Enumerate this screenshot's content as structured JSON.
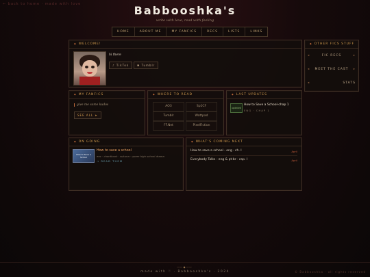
{
  "corner": {
    "top_left": "← back to home · made with love"
  },
  "header": {
    "title": "Babbooshka's",
    "tagline": "write with love, read with feeling"
  },
  "nav": [
    "HOME",
    "ABOUT ME",
    "MY FANFICS",
    "RECS",
    "LISTS",
    "LINKS"
  ],
  "welcome": {
    "heading": "WELCOME!",
    "greeting": "hi there",
    "links": [
      {
        "icon": "♪",
        "label": "TikTok"
      },
      {
        "icon": "✱",
        "label": "Tumblr"
      }
    ]
  },
  "other": {
    "heading": "OTHER FICS STUFF",
    "items": [
      "FIC RECS",
      "MEET THE CAST",
      "STATS"
    ]
  },
  "fanfics": {
    "heading": "MY FANFICS",
    "note": "give me some kudos",
    "button": "SEE ALL ➤"
  },
  "where": {
    "heading": "WHERE TO READ",
    "sites": [
      "AO3",
      "Sp1CF",
      "Tumblr",
      "Wattpad",
      "FF.Net",
      "PixelFiction"
    ]
  },
  "updates": {
    "heading": "LAST UPDATES",
    "badge": "updated",
    "title": "How to Save a School-chap 1",
    "meta": "ENG · CHAP 1"
  },
  "ongoing": {
    "heading": "ON GOING",
    "thumb_text": "How to Save a School",
    "title": "How to save a school",
    "desc": "enc · chantbook · sukuna · queer high school drama",
    "link": "→ READ THEM"
  },
  "coming": {
    "heading": "WHAT'S COMING NEXT",
    "items": [
      {
        "text": "How to save a school - eng · ch. I",
        "tag": "April"
      },
      {
        "text": "Everybody Talks - eng & pt-br · cap. I",
        "tag": "April"
      }
    ]
  },
  "footer": {
    "text": "made with ♡ · Babbooshka's · 2024",
    "right": "© Babbooshka · all rights reserved",
    "deco": "——  ◆  ——"
  },
  "colors": {
    "accent": "#d8a050",
    "background": "#160a0b",
    "tag": "#c05a3a"
  }
}
